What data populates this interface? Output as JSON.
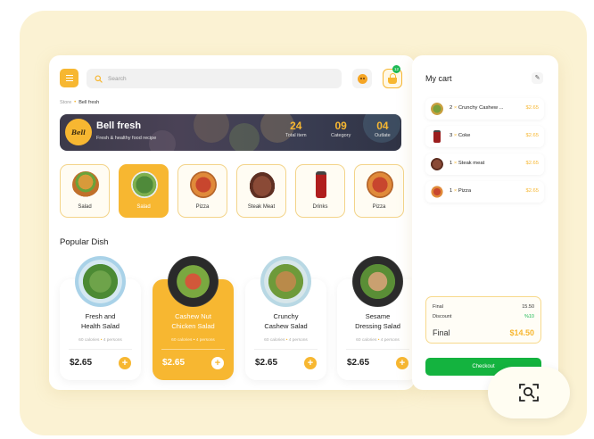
{
  "search": {
    "placeholder": "Search"
  },
  "cart_badge": "12",
  "breadcrumb": {
    "root": "Store",
    "current": "Bell fresh"
  },
  "banner": {
    "logo_text": "Bell",
    "title": "Bell fresh",
    "subtitle": "Fresh & healthy food recipe",
    "stats": [
      {
        "value": "24",
        "label": "Total item"
      },
      {
        "value": "09",
        "label": "Category"
      },
      {
        "value": "04",
        "label": "Outlate"
      }
    ]
  },
  "categories": [
    {
      "label": "Salad",
      "icon": "burger-icon",
      "active": false
    },
    {
      "label": "Salad",
      "icon": "salad-icon",
      "active": true
    },
    {
      "label": "Pizza",
      "icon": "pizza-icon",
      "active": false
    },
    {
      "label": "Steak Meat",
      "icon": "steak-icon",
      "active": false
    },
    {
      "label": "Drinks",
      "icon": "cola-icon",
      "active": false
    },
    {
      "label": "Pizza",
      "icon": "pizza-icon",
      "active": false
    }
  ],
  "popular": {
    "title": "Popular Dish",
    "dishes": [
      {
        "name_line1": "Fresh and",
        "name_line2": "Health Salad",
        "calories": "60 calories",
        "persons": "4 persons",
        "price": "$2.65",
        "active": false
      },
      {
        "name_line1": "Cashew Nut",
        "name_line2": "Chicken Salad",
        "calories": "60 calories",
        "persons": "4 persons",
        "price": "$2.65",
        "active": true
      },
      {
        "name_line1": "Crunchy",
        "name_line2": "Cashew Salad",
        "calories": "60 calories",
        "persons": "4 persons",
        "price": "$2.65",
        "active": false
      },
      {
        "name_line1": "Sesame",
        "name_line2": "Dressing Salad",
        "calories": "60 calories",
        "persons": "4 persons",
        "price": "$2.65",
        "active": false
      }
    ]
  },
  "cart": {
    "title": "My cart",
    "items": [
      {
        "qty": "2",
        "name": "Crunchy Cashew ...",
        "price": "$2.65"
      },
      {
        "qty": "3",
        "name": "Coke",
        "price": "$2.65"
      },
      {
        "qty": "1",
        "name": "Steak meat",
        "price": "$2.65"
      },
      {
        "qty": "1",
        "name": "Pizza",
        "price": "$2.65"
      }
    ],
    "summary": {
      "final_label": "Final",
      "final_value": "15.50",
      "discount_label": "Discount",
      "discount_value": "%10",
      "total_label": "Final",
      "total_value": "$14.50"
    },
    "checkout_label": "Checkout"
  },
  "colors": {
    "accent": "#f7b731",
    "green": "#14b33f",
    "background": "#fbf2d3"
  }
}
